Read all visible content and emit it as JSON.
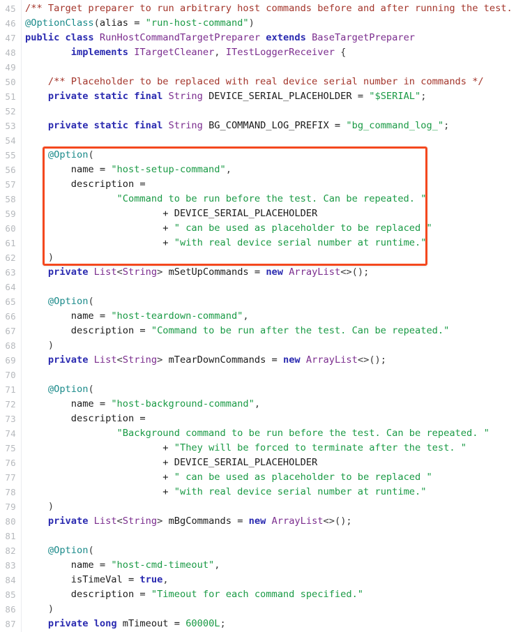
{
  "viewer": {
    "kind": "code-viewer",
    "language": "java",
    "background": "#ffffff",
    "first_line_number": 45,
    "last_line_number": 87
  },
  "annotation": {
    "shape": "rectangle",
    "color": "#f4481e",
    "covers_lines": "55-62",
    "label": ""
  },
  "colors": {
    "comment": "#a3352b",
    "keyword": "#2a2ab0",
    "type": "#7b2d8e",
    "string": "#1a9a45",
    "annotation": "#1a8a8a",
    "plain": "#1c1c1c",
    "line_number": "#b6b9bd",
    "highlight_border": "#f4481e"
  },
  "lines": [
    {
      "num": "45",
      "text": "/** Target preparer to run arbitrary host commands before and after running the test. */",
      "tokens": [
        {
          "c": "t-cmt",
          "t": "/** Target preparer to run arbitrary host commands before and after running the test. */"
        }
      ]
    },
    {
      "num": "46",
      "text": "@OptionClass(alias = \"run-host-command\")",
      "tokens": [
        {
          "c": "t-ann",
          "t": "@OptionClass"
        },
        {
          "c": "t-punc",
          "t": "("
        },
        {
          "c": "t-pln",
          "t": "alias = "
        },
        {
          "c": "t-str",
          "t": "\"run-host-command\""
        },
        {
          "c": "t-punc",
          "t": ")"
        }
      ]
    },
    {
      "num": "47",
      "text": "public class RunHostCommandTargetPreparer extends BaseTargetPreparer",
      "tokens": [
        {
          "c": "t-kw",
          "t": "public class "
        },
        {
          "c": "t-type",
          "t": "RunHostCommandTargetPreparer"
        },
        {
          "c": "t-kw",
          "t": " extends "
        },
        {
          "c": "t-type",
          "t": "BaseTargetPreparer"
        }
      ]
    },
    {
      "num": "48",
      "text": "        implements ITargetCleaner, ITestLoggerReceiver {",
      "tokens": [
        {
          "c": "t-pln",
          "t": "        "
        },
        {
          "c": "t-kw",
          "t": "implements "
        },
        {
          "c": "t-type",
          "t": "ITargetCleaner"
        },
        {
          "c": "t-punc",
          "t": ", "
        },
        {
          "c": "t-type",
          "t": "ITestLoggerReceiver"
        },
        {
          "c": "t-punc",
          "t": " {"
        }
      ]
    },
    {
      "num": "49",
      "text": "",
      "tokens": []
    },
    {
      "num": "50",
      "text": "    /** Placeholder to be replaced with real device serial number in commands */",
      "tokens": [
        {
          "c": "t-pln",
          "t": "    "
        },
        {
          "c": "t-cmt",
          "t": "/** Placeholder to be replaced with real device serial number in commands */"
        }
      ]
    },
    {
      "num": "51",
      "text": "    private static final String DEVICE_SERIAL_PLACEHOLDER = \"$SERIAL\";",
      "tokens": [
        {
          "c": "t-pln",
          "t": "    "
        },
        {
          "c": "t-kw",
          "t": "private static final "
        },
        {
          "c": "t-type",
          "t": "String"
        },
        {
          "c": "t-pln",
          "t": " DEVICE_SERIAL_PLACEHOLDER = "
        },
        {
          "c": "t-str",
          "t": "\"$SERIAL\""
        },
        {
          "c": "t-punc",
          "t": ";"
        }
      ]
    },
    {
      "num": "52",
      "text": "",
      "tokens": []
    },
    {
      "num": "53",
      "text": "    private static final String BG_COMMAND_LOG_PREFIX = \"bg_command_log_\";",
      "tokens": [
        {
          "c": "t-pln",
          "t": "    "
        },
        {
          "c": "t-kw",
          "t": "private static final "
        },
        {
          "c": "t-type",
          "t": "String"
        },
        {
          "c": "t-pln",
          "t": " BG_COMMAND_LOG_PREFIX = "
        },
        {
          "c": "t-str",
          "t": "\"bg_command_log_\""
        },
        {
          "c": "t-punc",
          "t": ";"
        }
      ]
    },
    {
      "num": "54",
      "text": "",
      "tokens": []
    },
    {
      "num": "55",
      "text": "    @Option(",
      "tokens": [
        {
          "c": "t-pln",
          "t": "    "
        },
        {
          "c": "t-ann",
          "t": "@Option"
        },
        {
          "c": "t-punc",
          "t": "("
        }
      ]
    },
    {
      "num": "56",
      "text": "        name = \"host-setup-command\",",
      "tokens": [
        {
          "c": "t-pln",
          "t": "        name = "
        },
        {
          "c": "t-str",
          "t": "\"host-setup-command\""
        },
        {
          "c": "t-punc",
          "t": ","
        }
      ]
    },
    {
      "num": "57",
      "text": "        description =",
      "tokens": [
        {
          "c": "t-pln",
          "t": "        description ="
        }
      ]
    },
    {
      "num": "58",
      "text": "                \"Command to be run before the test. Can be repeated. \"",
      "tokens": [
        {
          "c": "t-pln",
          "t": "                "
        },
        {
          "c": "t-str",
          "t": "\"Command to be run before the test. Can be repeated. \""
        }
      ]
    },
    {
      "num": "59",
      "text": "                        + DEVICE_SERIAL_PLACEHOLDER",
      "tokens": [
        {
          "c": "t-pln",
          "t": "                        + DEVICE_SERIAL_PLACEHOLDER"
        }
      ]
    },
    {
      "num": "60",
      "text": "                        + \" can be used as placeholder to be replaced \"",
      "tokens": [
        {
          "c": "t-pln",
          "t": "                        + "
        },
        {
          "c": "t-str",
          "t": "\" can be used as placeholder to be replaced \""
        }
      ]
    },
    {
      "num": "61",
      "text": "                        + \"with real device serial number at runtime.\"",
      "tokens": [
        {
          "c": "t-pln",
          "t": "                        + "
        },
        {
          "c": "t-str",
          "t": "\"with real device serial number at runtime.\""
        }
      ]
    },
    {
      "num": "62",
      "text": "    )",
      "tokens": [
        {
          "c": "t-pln",
          "t": "    "
        },
        {
          "c": "t-punc",
          "t": ")"
        }
      ]
    },
    {
      "num": "63",
      "text": "    private List<String> mSetUpCommands = new ArrayList<>();",
      "tokens": [
        {
          "c": "t-pln",
          "t": "    "
        },
        {
          "c": "t-kw",
          "t": "private "
        },
        {
          "c": "t-type",
          "t": "List"
        },
        {
          "c": "t-punc",
          "t": "<"
        },
        {
          "c": "t-type",
          "t": "String"
        },
        {
          "c": "t-punc",
          "t": "> "
        },
        {
          "c": "t-pln",
          "t": "mSetUpCommands = "
        },
        {
          "c": "t-kw",
          "t": "new "
        },
        {
          "c": "t-type",
          "t": "ArrayList"
        },
        {
          "c": "t-punc",
          "t": "<>();"
        }
      ]
    },
    {
      "num": "64",
      "text": "",
      "tokens": []
    },
    {
      "num": "65",
      "text": "    @Option(",
      "tokens": [
        {
          "c": "t-pln",
          "t": "    "
        },
        {
          "c": "t-ann",
          "t": "@Option"
        },
        {
          "c": "t-punc",
          "t": "("
        }
      ]
    },
    {
      "num": "66",
      "text": "        name = \"host-teardown-command\",",
      "tokens": [
        {
          "c": "t-pln",
          "t": "        name = "
        },
        {
          "c": "t-str",
          "t": "\"host-teardown-command\""
        },
        {
          "c": "t-punc",
          "t": ","
        }
      ]
    },
    {
      "num": "67",
      "text": "        description = \"Command to be run after the test. Can be repeated.\"",
      "tokens": [
        {
          "c": "t-pln",
          "t": "        description = "
        },
        {
          "c": "t-str",
          "t": "\"Command to be run after the test. Can be repeated.\""
        }
      ]
    },
    {
      "num": "68",
      "text": "    )",
      "tokens": [
        {
          "c": "t-pln",
          "t": "    "
        },
        {
          "c": "t-punc",
          "t": ")"
        }
      ]
    },
    {
      "num": "69",
      "text": "    private List<String> mTearDownCommands = new ArrayList<>();",
      "tokens": [
        {
          "c": "t-pln",
          "t": "    "
        },
        {
          "c": "t-kw",
          "t": "private "
        },
        {
          "c": "t-type",
          "t": "List"
        },
        {
          "c": "t-punc",
          "t": "<"
        },
        {
          "c": "t-type",
          "t": "String"
        },
        {
          "c": "t-punc",
          "t": "> "
        },
        {
          "c": "t-pln",
          "t": "mTearDownCommands = "
        },
        {
          "c": "t-kw",
          "t": "new "
        },
        {
          "c": "t-type",
          "t": "ArrayList"
        },
        {
          "c": "t-punc",
          "t": "<>();"
        }
      ]
    },
    {
      "num": "70",
      "text": "",
      "tokens": []
    },
    {
      "num": "71",
      "text": "    @Option(",
      "tokens": [
        {
          "c": "t-pln",
          "t": "    "
        },
        {
          "c": "t-ann",
          "t": "@Option"
        },
        {
          "c": "t-punc",
          "t": "("
        }
      ]
    },
    {
      "num": "72",
      "text": "        name = \"host-background-command\",",
      "tokens": [
        {
          "c": "t-pln",
          "t": "        name = "
        },
        {
          "c": "t-str",
          "t": "\"host-background-command\""
        },
        {
          "c": "t-punc",
          "t": ","
        }
      ]
    },
    {
      "num": "73",
      "text": "        description =",
      "tokens": [
        {
          "c": "t-pln",
          "t": "        description ="
        }
      ]
    },
    {
      "num": "74",
      "text": "                \"Background command to be run before the test. Can be repeated. \"",
      "tokens": [
        {
          "c": "t-pln",
          "t": "                "
        },
        {
          "c": "t-str",
          "t": "\"Background command to be run before the test. Can be repeated. \""
        }
      ]
    },
    {
      "num": "75",
      "text": "                        + \"They will be forced to terminate after the test. \"",
      "tokens": [
        {
          "c": "t-pln",
          "t": "                        + "
        },
        {
          "c": "t-str",
          "t": "\"They will be forced to terminate after the test. \""
        }
      ]
    },
    {
      "num": "76",
      "text": "                        + DEVICE_SERIAL_PLACEHOLDER",
      "tokens": [
        {
          "c": "t-pln",
          "t": "                        + DEVICE_SERIAL_PLACEHOLDER"
        }
      ]
    },
    {
      "num": "77",
      "text": "                        + \" can be used as placeholder to be replaced \"",
      "tokens": [
        {
          "c": "t-pln",
          "t": "                        + "
        },
        {
          "c": "t-str",
          "t": "\" can be used as placeholder to be replaced \""
        }
      ]
    },
    {
      "num": "78",
      "text": "                        + \"with real device serial number at runtime.\"",
      "tokens": [
        {
          "c": "t-pln",
          "t": "                        + "
        },
        {
          "c": "t-str",
          "t": "\"with real device serial number at runtime.\""
        }
      ]
    },
    {
      "num": "79",
      "text": "    )",
      "tokens": [
        {
          "c": "t-pln",
          "t": "    "
        },
        {
          "c": "t-punc",
          "t": ")"
        }
      ]
    },
    {
      "num": "80",
      "text": "    private List<String> mBgCommands = new ArrayList<>();",
      "tokens": [
        {
          "c": "t-pln",
          "t": "    "
        },
        {
          "c": "t-kw",
          "t": "private "
        },
        {
          "c": "t-type",
          "t": "List"
        },
        {
          "c": "t-punc",
          "t": "<"
        },
        {
          "c": "t-type",
          "t": "String"
        },
        {
          "c": "t-punc",
          "t": "> "
        },
        {
          "c": "t-pln",
          "t": "mBgCommands = "
        },
        {
          "c": "t-kw",
          "t": "new "
        },
        {
          "c": "t-type",
          "t": "ArrayList"
        },
        {
          "c": "t-punc",
          "t": "<>();"
        }
      ]
    },
    {
      "num": "81",
      "text": "",
      "tokens": []
    },
    {
      "num": "82",
      "text": "    @Option(",
      "tokens": [
        {
          "c": "t-pln",
          "t": "    "
        },
        {
          "c": "t-ann",
          "t": "@Option"
        },
        {
          "c": "t-punc",
          "t": "("
        }
      ]
    },
    {
      "num": "83",
      "text": "        name = \"host-cmd-timeout\",",
      "tokens": [
        {
          "c": "t-pln",
          "t": "        name = "
        },
        {
          "c": "t-str",
          "t": "\"host-cmd-timeout\""
        },
        {
          "c": "t-punc",
          "t": ","
        }
      ]
    },
    {
      "num": "84",
      "text": "        isTimeVal = true,",
      "tokens": [
        {
          "c": "t-pln",
          "t": "        isTimeVal = "
        },
        {
          "c": "t-kw",
          "t": "true"
        },
        {
          "c": "t-punc",
          "t": ","
        }
      ]
    },
    {
      "num": "85",
      "text": "        description = \"Timeout for each command specified.\"",
      "tokens": [
        {
          "c": "t-pln",
          "t": "        description = "
        },
        {
          "c": "t-str",
          "t": "\"Timeout for each command specified.\""
        }
      ]
    },
    {
      "num": "86",
      "text": "    )",
      "tokens": [
        {
          "c": "t-pln",
          "t": "    "
        },
        {
          "c": "t-punc",
          "t": ")"
        }
      ]
    },
    {
      "num": "87",
      "text": "    private long mTimeout = 60000L;",
      "tokens": [
        {
          "c": "t-pln",
          "t": "    "
        },
        {
          "c": "t-kw",
          "t": "private long "
        },
        {
          "c": "t-pln",
          "t": "mTimeout = "
        },
        {
          "c": "t-num",
          "t": "60000L"
        },
        {
          "c": "t-punc",
          "t": ";"
        }
      ]
    }
  ]
}
